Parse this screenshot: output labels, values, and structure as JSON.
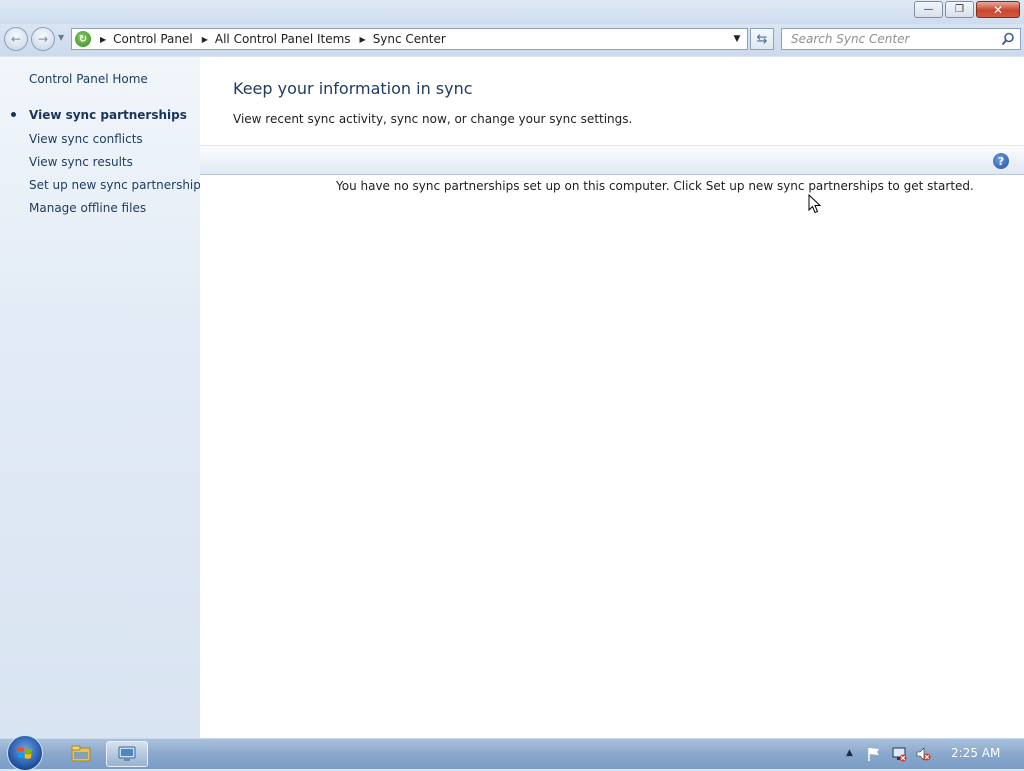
{
  "window": {
    "caption_buttons": {
      "minimize_icon": "minimize-icon",
      "maximize_icon": "restore-icon",
      "close_icon": "close-icon"
    }
  },
  "navbar": {
    "breadcrumb": [
      "Control Panel",
      "All Control Panel Items",
      "Sync Center"
    ],
    "search_placeholder": "Search Sync Center"
  },
  "sidebar": {
    "home_label": "Control Panel Home",
    "active_item": "View sync partnerships",
    "items": [
      "View sync conflicts",
      "View sync results",
      "Set up new sync partnerships",
      "Manage offline files"
    ]
  },
  "main": {
    "title": "Keep your information in sync",
    "description": "View recent sync activity, sync now, or change your sync settings.",
    "empty_message": "You have no sync partnerships set up on this computer. Click Set up new sync partnerships to get started.",
    "help_label": "?"
  },
  "taskbar": {
    "clock": "2:25 AM",
    "pinned": [
      "windows-explorer-icon",
      "sync-center-icon"
    ],
    "tray": [
      "show-hidden-icons-icon",
      "action-center-flag-icon",
      "network-disconnected-icon",
      "volume-muted-icon"
    ]
  },
  "colors": {
    "accent_title": "#1e3c64",
    "link": "#1e3d63",
    "close_button": "#c7472e",
    "taskbar": "#8aa8cc"
  }
}
